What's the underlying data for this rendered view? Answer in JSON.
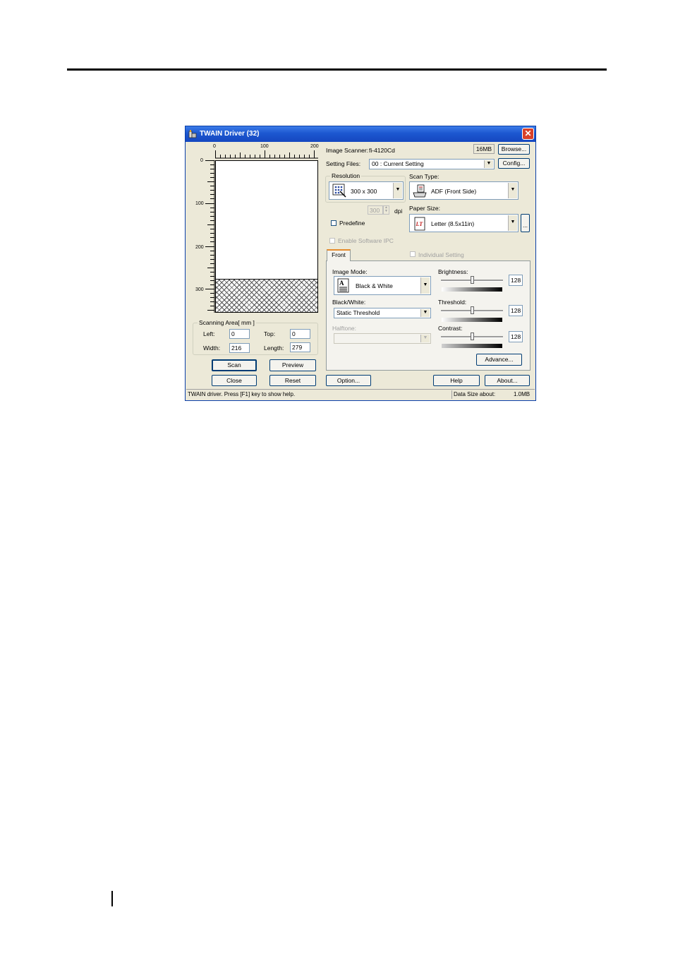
{
  "window": {
    "title": "TWAIN Driver (32)"
  },
  "ruler": {
    "top_ticks": [
      "0",
      "100",
      "200"
    ],
    "left_ticks": [
      "0",
      "100",
      "200",
      "300"
    ]
  },
  "scanning_area": {
    "caption": "Scanning Area[ mm ]",
    "left_label": "Left:",
    "left_value": "0",
    "top_label": "Top:",
    "top_value": "0",
    "width_label": "Width:",
    "width_value": "216",
    "length_label": "Length:",
    "length_value": "279"
  },
  "left_buttons": {
    "scan": "Scan",
    "preview": "Preview",
    "close": "Close",
    "reset": "Reset"
  },
  "scanner": {
    "label": "Image Scanner:",
    "model": "fi-4120Cd",
    "memory": "16MB",
    "browse": "Browse..."
  },
  "setting_files": {
    "label": "Setting Files:",
    "value": "00 : Current Setting",
    "config": "Config..."
  },
  "resolution": {
    "caption": "Resolution",
    "value": "300 x 300",
    "custom_dpi": "300",
    "dpi_label": "dpi",
    "predefine_label": "Predefine"
  },
  "scan_type": {
    "label": "Scan Type:",
    "value": "ADF (Front Side)"
  },
  "paper_size": {
    "label": "Paper Size:",
    "value": "Letter (8.5x11in)",
    "more": "..."
  },
  "enable_software_ipc": "Enable Software IPC",
  "tabs": {
    "front": "Front",
    "individual_setting": "Individual Setting"
  },
  "image_mode": {
    "label": "Image Mode:",
    "value": "Black & White"
  },
  "black_white": {
    "label": "Black/White:",
    "value": "Static Threshold"
  },
  "halftone": {
    "label": "Halftone:",
    "value": ""
  },
  "brightness": {
    "label": "Brightness:",
    "value": "128",
    "level": 0.5
  },
  "threshold": {
    "label": "Threshold:",
    "value": "128",
    "level": 0.5
  },
  "contrast": {
    "label": "Contrast:",
    "value": "128",
    "level": 0.5
  },
  "advance_button": "Advance...",
  "bottom_buttons": {
    "option": "Option...",
    "help": "Help",
    "about": "About..."
  },
  "status": {
    "help_text": "TWAIN driver. Press [F1] key to show help.",
    "data_size_label": "Data Size about:",
    "data_size_value": "1.0MB"
  },
  "colors": {
    "title_bar": "#1c57d0",
    "dialog_bg": "#ece9d8",
    "close_button": "#d9412a"
  }
}
